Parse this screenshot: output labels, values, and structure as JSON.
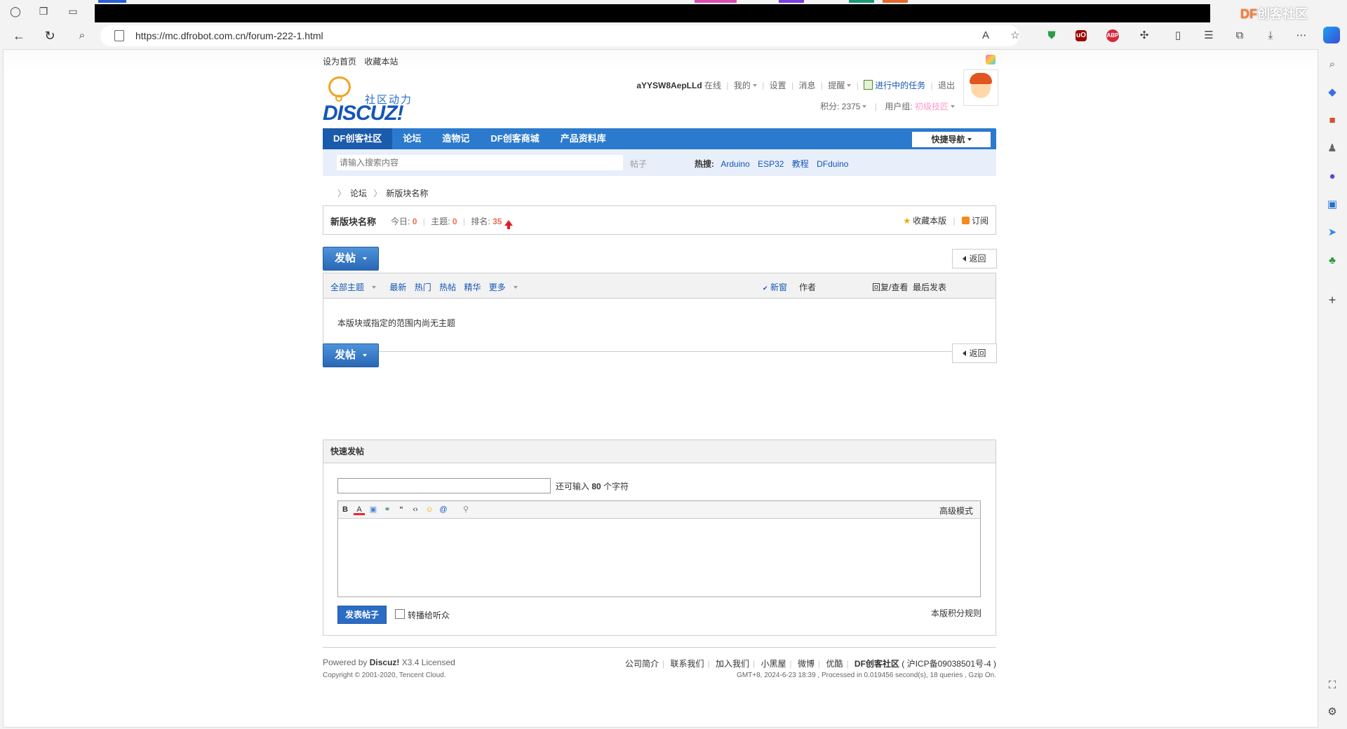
{
  "browser": {
    "url": "https://mc.dfrobot.com.cn/forum-222-1.html",
    "watermark_df": "DF",
    "watermark_text": "创客社区"
  },
  "topbar": {
    "set_home": "设为首页",
    "bookmark": "收藏本站"
  },
  "logo": {
    "cn": "社区动力",
    "en": "DISCUZ!"
  },
  "user": {
    "name": "aYYSW8AepLLd",
    "status": "在线",
    "mine": "我的",
    "settings": "设置",
    "messages": "消息",
    "reminders": "提醒",
    "tasks": "进行中的任务",
    "logout": "退出",
    "points_label": "积分: 2375",
    "group_label": "用户组:",
    "group_value": "初级技匠"
  },
  "nav": {
    "items": [
      "DF创客社区",
      "论坛",
      "造物记",
      "DF创客商城",
      "产品资料库"
    ],
    "quicknav": "快捷导航"
  },
  "search": {
    "placeholder": "请输入搜索内容",
    "type": "帖子",
    "hot_label": "热搜:",
    "hot_keywords": [
      "Arduino",
      "ESP32",
      "教程",
      "DFduino"
    ]
  },
  "breadcrumb": [
    "论坛",
    "新版块名称"
  ],
  "forum": {
    "name": "新版块名称",
    "today_label": "今日:",
    "today": "0",
    "threads_label": "主题:",
    "threads": "0",
    "rank_label": "排名:",
    "rank": "35",
    "favorite": "收藏本版",
    "subscribe": "订阅"
  },
  "buttons": {
    "post": "发帖",
    "back": "返回"
  },
  "threadlist": {
    "filters": [
      "全部主题",
      "最新",
      "热门",
      "热帖",
      "精华",
      "更多"
    ],
    "new_window": "新窗",
    "author": "作者",
    "replies": "回复/查看",
    "last_post": "最后发表",
    "empty": "本版块或指定的范围内尚无主题"
  },
  "fastpost": {
    "title": "快速发帖",
    "remain_prefix": "还可输入",
    "remain_count": "80",
    "remain_suffix": "个字符",
    "advanced": "高级模式",
    "submit": "发表帖子",
    "broadcast": "转播给听众",
    "rules": "本版积分规则"
  },
  "footer": {
    "powered_prefix": "Powered by",
    "powered_brand": "Discuz!",
    "powered_suffix": "X3.4 Licensed",
    "copyright": "Copyright © 2001-2020, Tencent Cloud.",
    "links": [
      "公司简介",
      "联系我们",
      "加入我们",
      "小黑屋",
      "微博",
      "优酷"
    ],
    "site": "DF创客社区",
    "icp": "( 沪ICP备09038501号-4 )",
    "gmt": "GMT+8, 2024-6-23 18:39 , Processed in 0.019456 second(s), 18 queries , Gzip On."
  }
}
